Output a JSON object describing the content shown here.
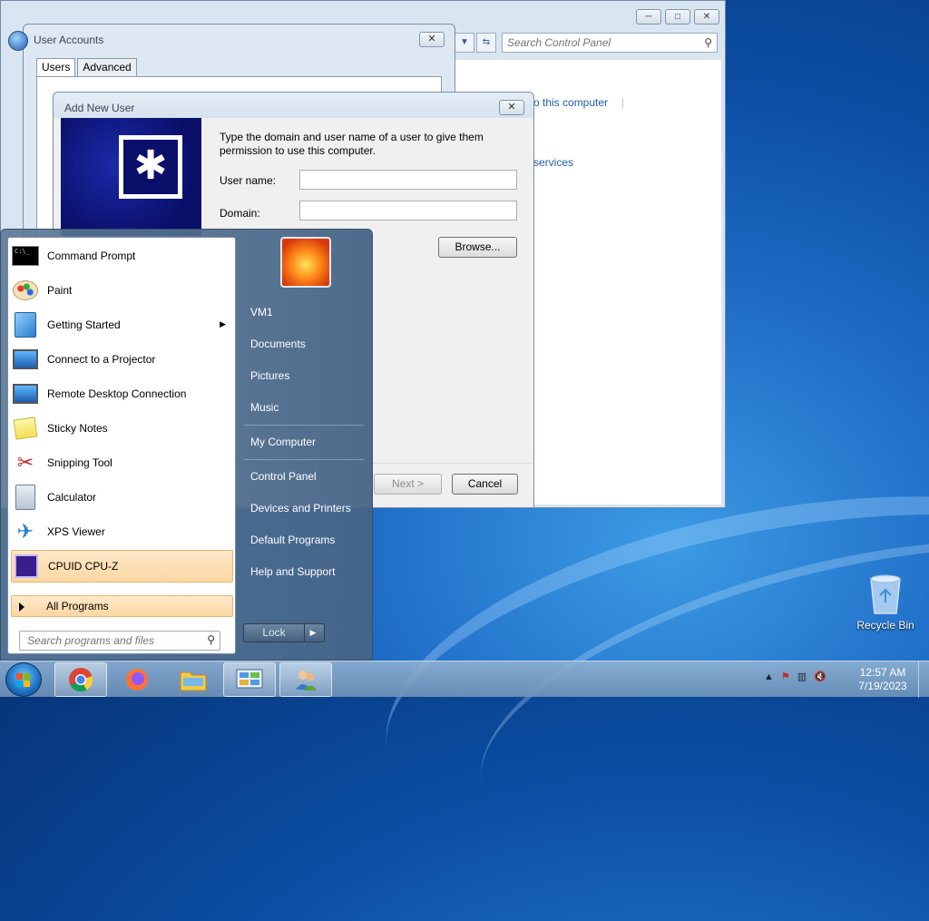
{
  "control_panel": {
    "search_placeholder": "Search Control Panel",
    "link_computer": "o this computer",
    "link_services": "services",
    "minimize": "─",
    "maximize": "□",
    "close": "✕"
  },
  "user_accounts": {
    "title": "User Accounts",
    "tabs": [
      "Users",
      "Advanced"
    ],
    "close": "✕"
  },
  "add_new_user": {
    "title": "Add New User",
    "description": "Type the domain and user name of a user to give them permission to use this computer.",
    "username_label": "User name:",
    "domain_label": "Domain:",
    "browse_button": "Browse...",
    "next_button": "Next >",
    "cancel_button": "Cancel",
    "close": "✕"
  },
  "start_menu": {
    "programs": [
      {
        "label": "Command Prompt",
        "icon": "command-prompt-icon"
      },
      {
        "label": "Paint",
        "icon": "paint-icon"
      },
      {
        "label": "Getting Started",
        "icon": "getting-started-icon",
        "submenu": true
      },
      {
        "label": "Connect to a Projector",
        "icon": "projector-icon"
      },
      {
        "label": "Remote Desktop Connection",
        "icon": "remote-desktop-icon"
      },
      {
        "label": "Sticky Notes",
        "icon": "sticky-notes-icon"
      },
      {
        "label": "Snipping Tool",
        "icon": "snipping-tool-icon"
      },
      {
        "label": "Calculator",
        "icon": "calculator-icon"
      },
      {
        "label": "XPS Viewer",
        "icon": "xps-viewer-icon"
      },
      {
        "label": "CPUID CPU-Z",
        "icon": "cpu-z-icon",
        "highlight": true
      }
    ],
    "all_programs": "All Programs",
    "search_placeholder": "Search programs and files",
    "right_items": [
      "VM1",
      "Documents",
      "Pictures",
      "Music",
      "My Computer",
      "Control Panel",
      "Devices and Printers",
      "Default Programs",
      "Help and Support"
    ],
    "lock_button": "Lock",
    "lock_arrow": "▶",
    "submenu_arrow": "▶"
  },
  "desktop": {
    "recycle_bin": "Recycle Bin"
  },
  "taskbar": {
    "time": "12:57 AM",
    "date": "7/19/2023"
  }
}
